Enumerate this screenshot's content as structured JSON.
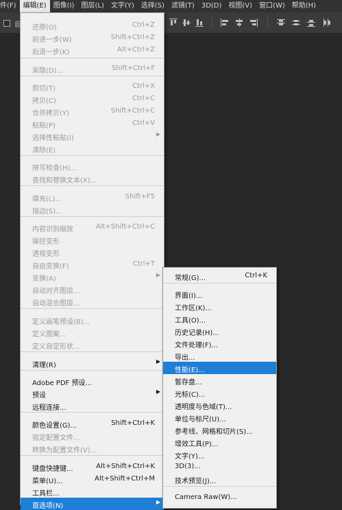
{
  "menubar": [
    "件(F)",
    "编辑(E)",
    "图像(I)",
    "图层(L)",
    "文字(Y)",
    "选择(S)",
    "滤镜(T)",
    "3D(D)",
    "视图(V)",
    "窗口(W)",
    "帮助(H)"
  ],
  "options_bar": {
    "checkbox_label": "自"
  },
  "edit_menu": {
    "items": [
      {
        "label": "还原(O)",
        "shortcut": "Ctrl+Z",
        "disabled": true
      },
      {
        "label": "前进一步(W)",
        "shortcut": "Shift+Ctrl+Z",
        "disabled": true
      },
      {
        "label": "后退一步(K)",
        "shortcut": "Alt+Ctrl+Z",
        "disabled": true
      },
      {
        "label": "渐隐(D)...",
        "shortcut": "Shift+Ctrl+F",
        "disabled": true
      },
      {
        "label": "剪切(T)",
        "shortcut": "Ctrl+X",
        "disabled": true
      },
      {
        "label": "拷贝(C)",
        "shortcut": "Ctrl+C",
        "disabled": true
      },
      {
        "label": "合并拷贝(Y)",
        "shortcut": "Shift+Ctrl+C",
        "disabled": true
      },
      {
        "label": "粘贴(P)",
        "shortcut": "Ctrl+V",
        "disabled": true
      },
      {
        "label": "选择性粘贴(I)",
        "shortcut": "",
        "disabled": true,
        "submenu": true
      },
      {
        "label": "清除(E)",
        "shortcut": "",
        "disabled": true
      },
      {
        "label": "拼写检查(H)...",
        "shortcut": "",
        "disabled": true
      },
      {
        "label": "查找和替换文本(X)...",
        "shortcut": "",
        "disabled": true
      },
      {
        "label": "填充(L)...",
        "shortcut": "Shift+F5",
        "disabled": true
      },
      {
        "label": "描边(S)...",
        "shortcut": "",
        "disabled": true
      },
      {
        "label": "内容识别缩放",
        "shortcut": "Alt+Shift+Ctrl+C",
        "disabled": true
      },
      {
        "label": "操控变形",
        "shortcut": "",
        "disabled": true
      },
      {
        "label": "透视变形",
        "shortcut": "",
        "disabled": true
      },
      {
        "label": "自由变换(F)",
        "shortcut": "Ctrl+T",
        "disabled": true
      },
      {
        "label": "变换(A)",
        "shortcut": "",
        "disabled": true,
        "submenu": true
      },
      {
        "label": "自动对齐图层...",
        "shortcut": "",
        "disabled": true
      },
      {
        "label": "自动混合图层...",
        "shortcut": "",
        "disabled": true
      },
      {
        "label": "定义画笔预设(B)...",
        "shortcut": "",
        "disabled": true
      },
      {
        "label": "定义图案...",
        "shortcut": "",
        "disabled": true
      },
      {
        "label": "定义自定形状...",
        "shortcut": "",
        "disabled": true
      },
      {
        "label": "清理(R)",
        "shortcut": "",
        "disabled": false,
        "submenu": true
      },
      {
        "label": "Adobe PDF 预设...",
        "shortcut": "",
        "disabled": false
      },
      {
        "label": "预设",
        "shortcut": "",
        "disabled": false,
        "submenu": true
      },
      {
        "label": "远程连接...",
        "shortcut": "",
        "disabled": false
      },
      {
        "label": "颜色设置(G)...",
        "shortcut": "Shift+Ctrl+K",
        "disabled": false
      },
      {
        "label": "指定配置文件...",
        "shortcut": "",
        "disabled": true
      },
      {
        "label": "转换为配置文件(V)...",
        "shortcut": "",
        "disabled": true
      },
      {
        "label": "键盘快捷键...",
        "shortcut": "Alt+Shift+Ctrl+K",
        "disabled": false
      },
      {
        "label": "菜单(U)...",
        "shortcut": "Alt+Shift+Ctrl+M",
        "disabled": false
      },
      {
        "label": "工具栏...",
        "shortcut": "",
        "disabled": false
      },
      {
        "label": "首选项(N)",
        "shortcut": "",
        "disabled": false,
        "submenu": true,
        "highlighted": true
      }
    ]
  },
  "prefs_menu": {
    "items": [
      {
        "label": "常规(G)...",
        "shortcut": "Ctrl+K"
      },
      {
        "label": "界面(I)...",
        "shortcut": ""
      },
      {
        "label": "工作区(K)...",
        "shortcut": ""
      },
      {
        "label": "工具(O)...",
        "shortcut": ""
      },
      {
        "label": "历史记录(H)...",
        "shortcut": ""
      },
      {
        "label": "文件处理(F)...",
        "shortcut": ""
      },
      {
        "label": "导出...",
        "shortcut": ""
      },
      {
        "label": "性能(E)...",
        "shortcut": "",
        "highlighted": true
      },
      {
        "label": "暂存盘...",
        "shortcut": ""
      },
      {
        "label": "光标(C)...",
        "shortcut": ""
      },
      {
        "label": "透明度与色域(T)...",
        "shortcut": ""
      },
      {
        "label": "单位与标尺(U)...",
        "shortcut": ""
      },
      {
        "label": "参考线、网格和切片(S)...",
        "shortcut": ""
      },
      {
        "label": "增效工具(P)...",
        "shortcut": ""
      },
      {
        "label": "文字(Y)...",
        "shortcut": ""
      },
      {
        "label": "3D(3)...",
        "shortcut": ""
      },
      {
        "label": "技术预览(J)...",
        "shortcut": ""
      },
      {
        "label": "Camera Raw(W)...",
        "shortcut": ""
      }
    ]
  },
  "colors": {
    "highlight": "#1e7fd4",
    "menu_bg": "#f0f0f0",
    "disabled_text": "#9a9a9a"
  }
}
